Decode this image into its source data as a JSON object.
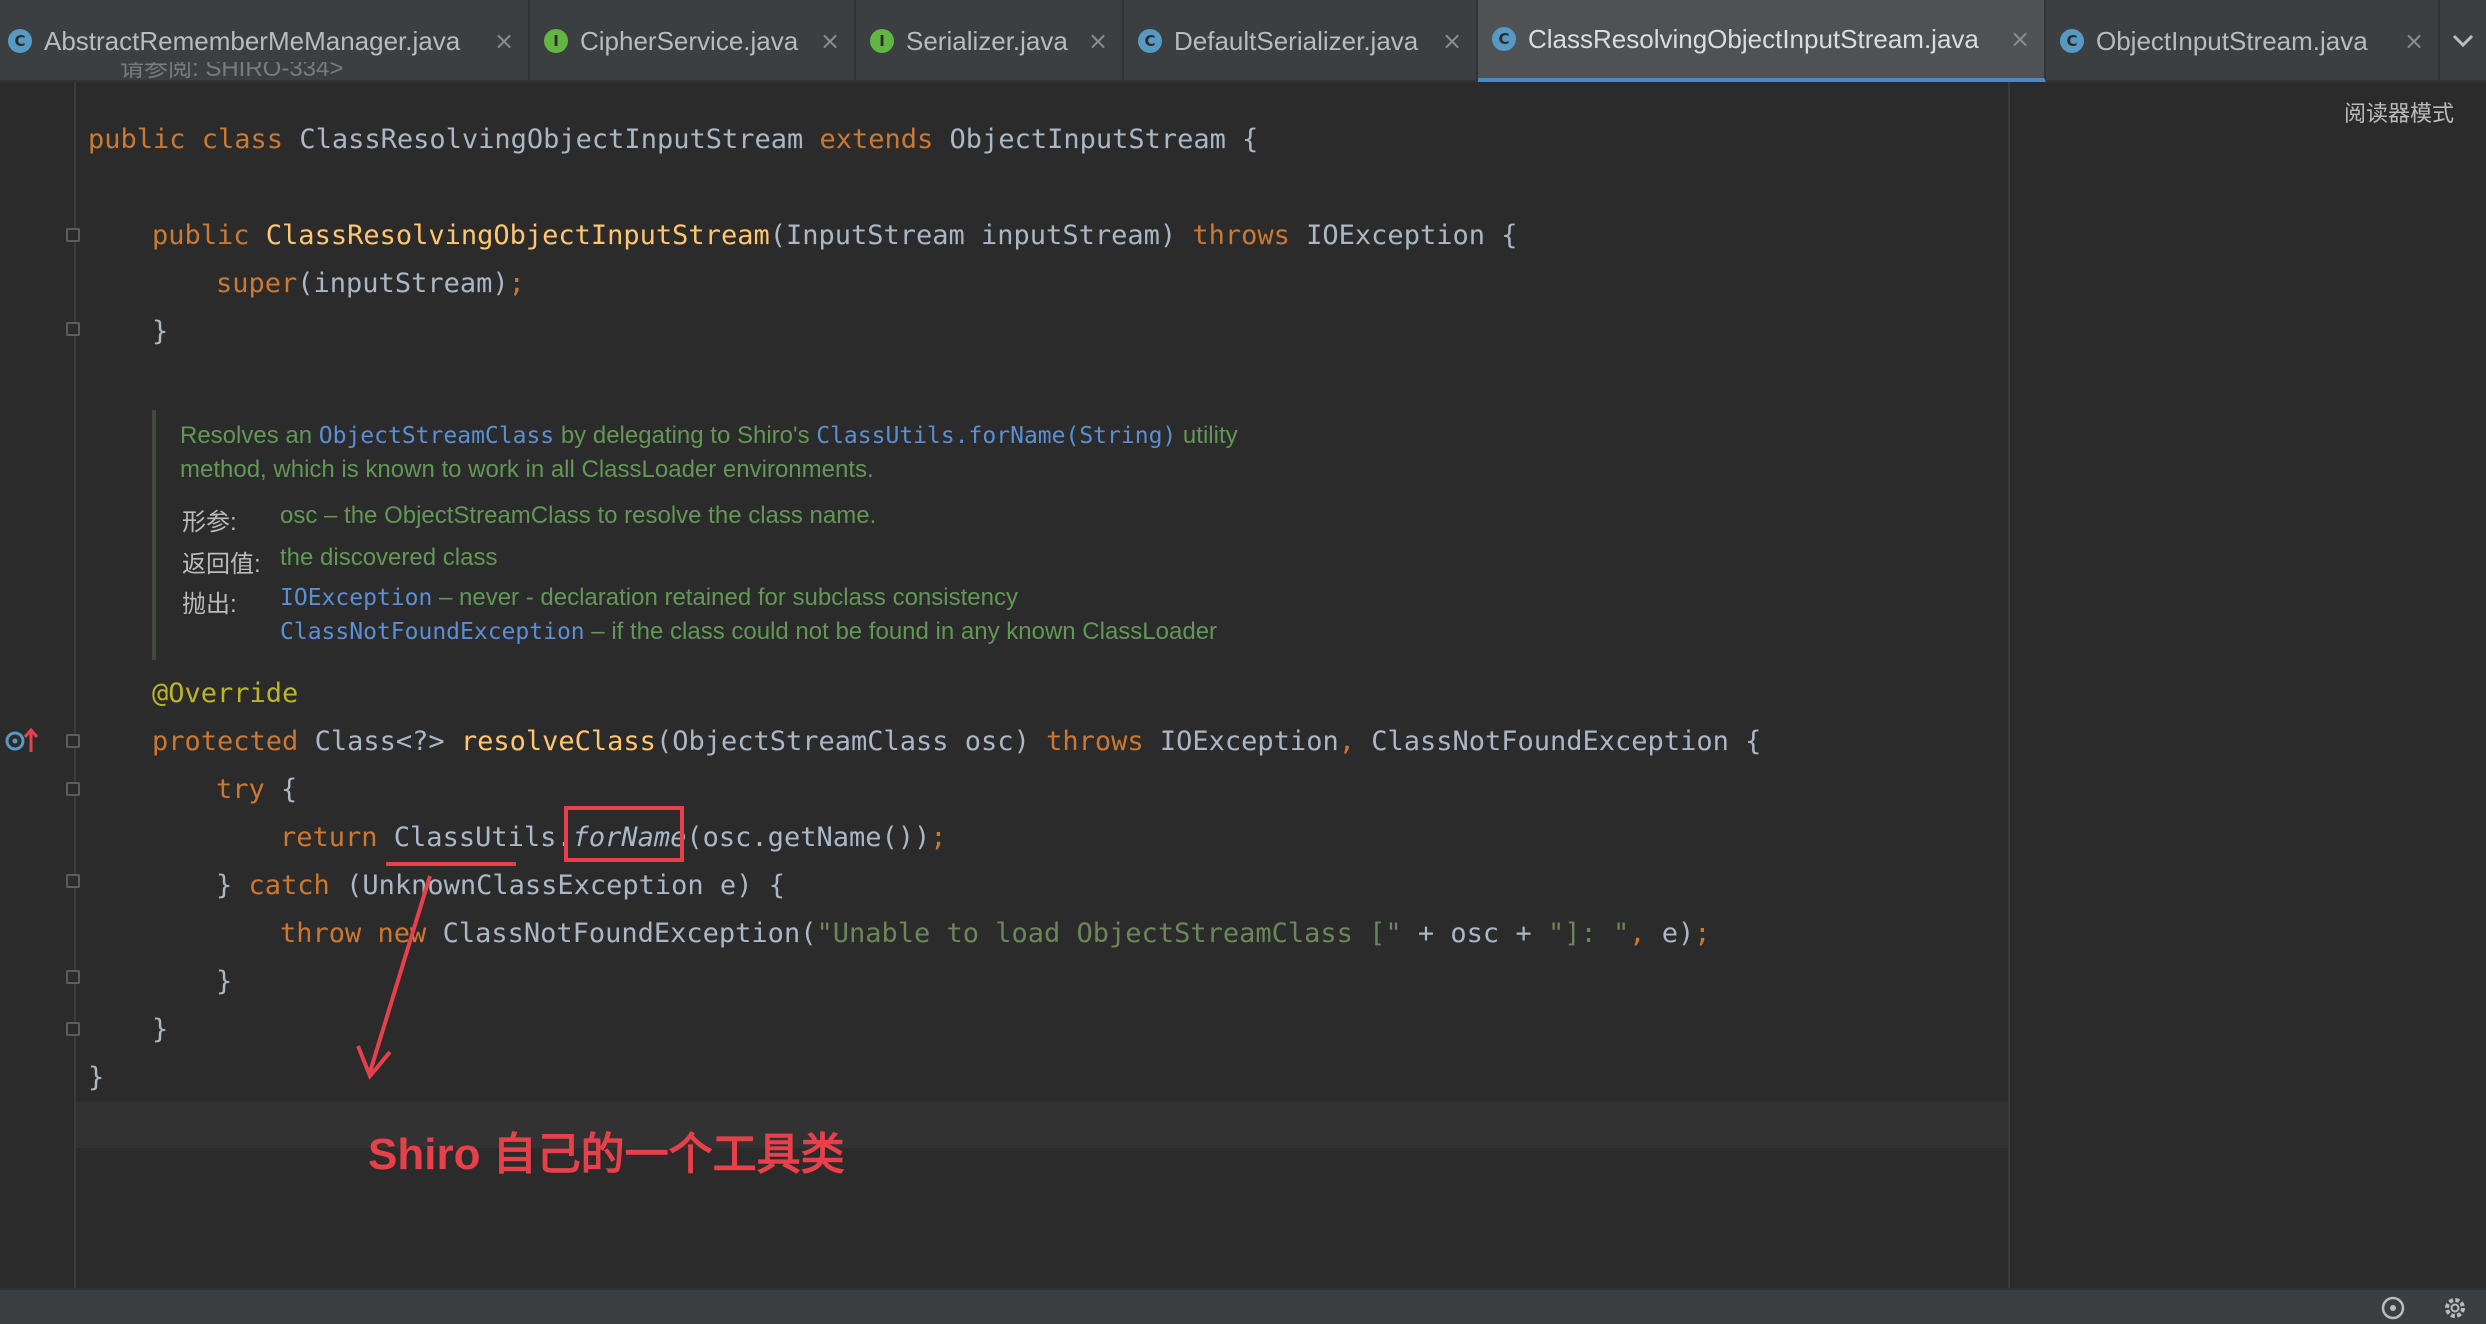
{
  "tabs": [
    {
      "icon": "c",
      "label": "AbstractRememberMeManager.java"
    },
    {
      "icon": "i",
      "label": "CipherService.java"
    },
    {
      "icon": "i",
      "label": "Serializer.java"
    },
    {
      "icon": "c",
      "label": "DefaultSerializer.java"
    },
    {
      "icon": "c",
      "label": "ClassResolvingObjectInputStream.java",
      "active": true
    },
    {
      "icon": "c",
      "label": "ObjectInputStream.java"
    }
  ],
  "icon_close": "×",
  "reader_mode": "阅读器模式",
  "cut_line": "请参阅: SHIRO-334>",
  "code": {
    "l1": {
      "k1": "public class ",
      "n": "ClassResolvingObjectInputStream ",
      "k2": "extends ",
      "p": "ObjectInputStream {"
    },
    "l2": {
      "k1": "public ",
      "f": "ClassResolvingObjectInputStream",
      "p1": "(InputStream inputStream) ",
      "k2": "throws ",
      "p2": "IOException {"
    },
    "l3": {
      "k": "super",
      "p": "(inputStream)",
      "s": ";"
    },
    "l4": "}",
    "l5": "@Override",
    "l6": {
      "k1": "protected ",
      "p1": "Class<?> ",
      "f": "resolveClass",
      "p2": "(ObjectStreamClass osc) ",
      "k2": "throws ",
      "p3": "IOException",
      ",": ", ",
      "p4": "ClassNotFoundException {"
    },
    "l7": {
      "k": "try ",
      "p": "{"
    },
    "l8": {
      "k": "return ",
      "p1": "ClassUtils.",
      "m": "forName",
      "p2": "(osc.getName())",
      "s": ";"
    },
    "l9": {
      "p1": "} ",
      "k": "catch ",
      "p2": "(UnknownClassException e) {"
    },
    "l10": {
      "k1": "throw ",
      "k2": "new ",
      "p1": "ClassNotFoundException(",
      "s1": "\"Unable to load ObjectStreamClass [\"",
      "p2": " + osc + ",
      "s2": "\"]: \"",
      ",": ", ",
      "p3": "e)",
      "s": ";"
    },
    "l11": "}",
    "l12": "}",
    "l13": "}"
  },
  "javadoc": {
    "d1a": "Resolves an ",
    "d1b": "ObjectStreamClass",
    "d1c": " by delegating to Shiro's ",
    "d1d": "ClassUtils.forName(String)",
    "d1e": " utility",
    "d2": "method, which is known to work in all ClassLoader environments.",
    "param_label": "形参:",
    "param_text": "osc – the ObjectStreamClass to resolve the class name.",
    "return_label": "返回值:",
    "return_text": "the discovered class",
    "throws_label": "抛出:",
    "t1_code": "IOException",
    "t1_text": " – never - declaration retained for subclass consistency",
    "t2_code": "ClassNotFoundException",
    "t2_text": " – if the class could not be found in any known ClassLoader"
  },
  "annotation": "Shiro 自己的一个工具类",
  "colors": {
    "annotation": "#e8404a",
    "keyword": "#cc7832",
    "method": "#ffc66d",
    "string": "#6a8759",
    "doc": "#629755",
    "doc_code": "#5b8fd5",
    "active_tab_underline": "#4a88c7"
  }
}
